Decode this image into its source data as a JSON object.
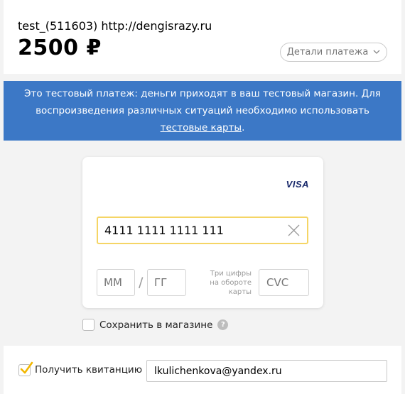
{
  "header": {
    "merchant": "test_(511603) http://dengisrazy.ru",
    "amount": "2500 ₽",
    "details_label": "Детали платежа"
  },
  "banner": {
    "line1": "Это тестовый платеж: деньги приходят в ваш тестовый магазин. Для",
    "line2": "воспроизведения различных ситуаций необходимо использовать",
    "link": "тестовые карты",
    "tail": "."
  },
  "card": {
    "brand": "VISA",
    "number_value": "4111 1111 1111 111",
    "month_placeholder": "ММ",
    "year_placeholder": "ГГ",
    "separator": "/",
    "cvc_hint": "Три цифры на обороте карты",
    "cvc_placeholder": "CVC"
  },
  "save": {
    "label": "Сохранить в магазине",
    "checked": false,
    "help": "?"
  },
  "receipt": {
    "label": "Получить квитанцию",
    "checked": true,
    "email_value": "lkulichenkova@yandex.ru"
  },
  "colors": {
    "banner": "#3c78c6",
    "focus_border": "#f5d565",
    "check_mark": "#f2b700"
  }
}
